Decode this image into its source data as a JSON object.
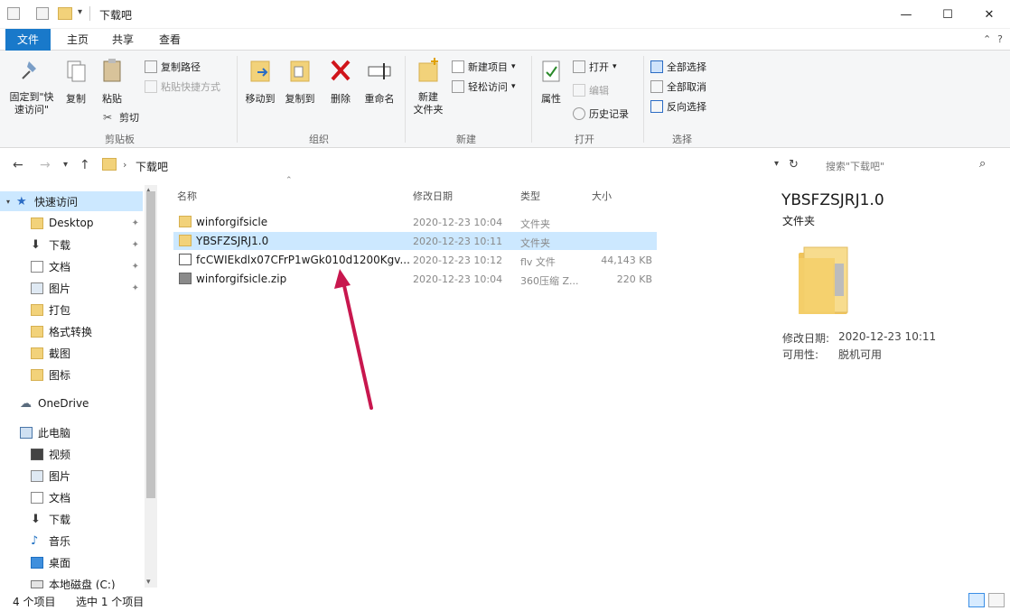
{
  "window": {
    "title": "下载吧",
    "minimize": "—",
    "maximize": "☐",
    "close": "✕"
  },
  "ribbon_tabs": [
    "文件",
    "主页",
    "共享",
    "查看"
  ],
  "ribbon": {
    "clipboard": {
      "pin": "固定到\"快\n速访问\"",
      "copy": "复制",
      "paste": "粘贴",
      "copy_path": "复制路径",
      "paste_shortcut": "粘贴快捷方式",
      "cut": "剪切",
      "label": "剪贴板"
    },
    "organize": {
      "move_to": "移动到",
      "copy_to": "复制到",
      "delete": "删除",
      "rename": "重命名",
      "label": "组织"
    },
    "new": {
      "new_folder": "新建\n文件夹",
      "new_item": "新建项目",
      "easy_access": "轻松访问",
      "label": "新建"
    },
    "open": {
      "properties": "属性",
      "open": "打开",
      "edit": "编辑",
      "history": "历史记录",
      "label": "打开"
    },
    "select": {
      "select_all": "全部选择",
      "select_none": "全部取消",
      "invert": "反向选择",
      "label": "选择"
    }
  },
  "address": {
    "path": "下载吧",
    "search_placeholder": "搜索\"下载吧\""
  },
  "nav": {
    "quick_access": "快速访问",
    "items": [
      "Desktop",
      "下载",
      "文档",
      "图片",
      "打包",
      "格式转换",
      "截图",
      "图标"
    ],
    "onedrive": "OneDrive",
    "this_pc": "此电脑",
    "pc_items": [
      "视频",
      "图片",
      "文档",
      "下载",
      "音乐",
      "桌面",
      "本地磁盘 (C:)"
    ]
  },
  "columns": [
    "名称",
    "修改日期",
    "类型",
    "大小"
  ],
  "files": [
    {
      "name": "winforgifsicle",
      "date": "2020-12-23 10:04",
      "type": "文件夹",
      "size": ""
    },
    {
      "name": "YBSFZSJRJ1.0",
      "date": "2020-12-23 10:11",
      "type": "文件夹",
      "size": ""
    },
    {
      "name": "fcCWIEkdlx07CFrP1wGk010d1200Kgv...",
      "date": "2020-12-23 10:12",
      "type": "flv 文件",
      "size": "44,143 KB"
    },
    {
      "name": "winforgifsicle.zip",
      "date": "2020-12-23 10:04",
      "type": "360压缩 Z...",
      "size": "220 KB"
    }
  ],
  "preview": {
    "name": "YBSFZSJRJ1.0",
    "type": "文件夹",
    "modified_label": "修改日期:",
    "modified_value": "2020-12-23 10:11",
    "avail_label": "可用性:",
    "avail_value": "脱机可用"
  },
  "status": {
    "count": "4 个项目",
    "selected": "选中 1 个项目"
  },
  "colors": {
    "accent": "#1979ca",
    "selection": "#cce8ff",
    "folder": "#f2d27a",
    "arrow": "#c8174e"
  }
}
